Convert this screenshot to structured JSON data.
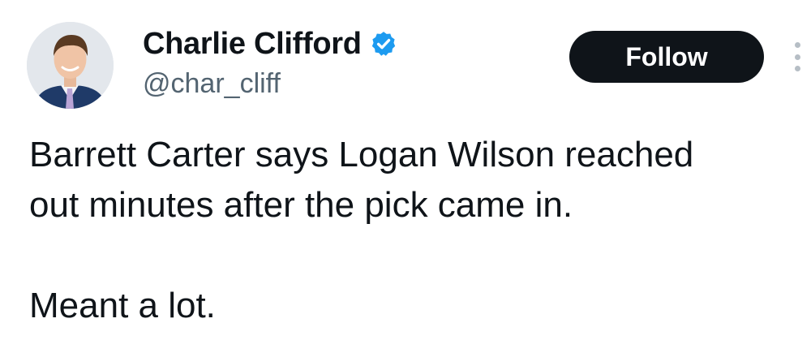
{
  "tweet": {
    "author": {
      "display_name": "Charlie Clifford",
      "handle": "@char_cliff",
      "verified": true,
      "avatar_icon": "profile-photo"
    },
    "follow_label": "Follow",
    "more_icon": "more-vertical-icon",
    "text_lines": [
      "Barrett Carter says Logan Wilson reached",
      "out minutes after the pick came in.",
      "",
      "Meant a lot."
    ]
  },
  "colors": {
    "text": "#0f1419",
    "secondary_text": "#536471",
    "follow_bg": "#0f1419",
    "follow_text": "#ffffff",
    "verified_badge": "#1d9bf0"
  }
}
